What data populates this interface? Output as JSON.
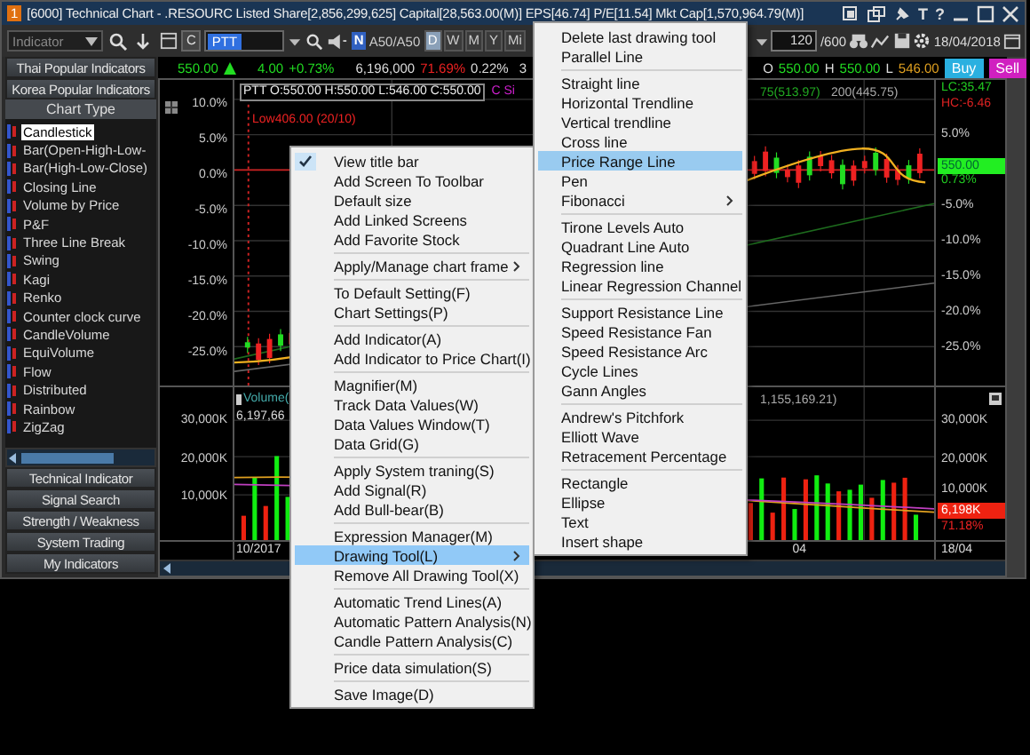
{
  "window": {
    "badge": "1",
    "title": "[6000] Technical Chart - .RESOURC Listed Share[2,856,299,625] Capital[28,563.00(M)] EPS[46.74] P/E[11.54] Mkt Cap[1,570,964.79(M)]",
    "title_buttons": [
      "T",
      "?"
    ]
  },
  "toolbar": {
    "indicator_dropdown": "Indicator",
    "c_button": "C",
    "symbol": "PTT",
    "market_badge": "N",
    "market": "A50/A50",
    "periods": [
      {
        "label": "D",
        "selected": true
      },
      {
        "label": "W",
        "selected": false
      },
      {
        "label": "M",
        "selected": false
      },
      {
        "label": "Y",
        "selected": false
      },
      {
        "label": "Mi",
        "selected": false
      }
    ],
    "count": "120",
    "count_max": "/600",
    "date": "18/04/2018"
  },
  "quote": {
    "last": "550.00",
    "change": "4.00",
    "change_pct": "+0.73%",
    "volume": "6,196,000",
    "ratio": "71.69%",
    "share": "0.22%",
    "column_7": "3",
    "open_label": "O",
    "open": "550.00",
    "high_label": "H",
    "high": "550.00",
    "low_label": "L",
    "low": "546.00",
    "buy": "Buy",
    "sell": "Sell"
  },
  "sidebar": {
    "top_buttons": [
      "Thai Popular Indicators",
      "Korea Popular Indicators"
    ],
    "section": "Chart Type",
    "items": [
      {
        "label": "Candlestick",
        "selected": true
      },
      {
        "label": "Bar(Open-High-Low-",
        "selected": false
      },
      {
        "label": "Bar(High-Low-Close)",
        "selected": false
      },
      {
        "label": "Closing Line",
        "selected": false
      },
      {
        "label": "Volume by Price",
        "selected": false
      },
      {
        "label": "P&F",
        "selected": false
      },
      {
        "label": "Three Line Break",
        "selected": false
      },
      {
        "label": "Swing",
        "selected": false
      },
      {
        "label": "Kagi",
        "selected": false
      },
      {
        "label": "Renko",
        "selected": false
      },
      {
        "label": "Counter clock curve",
        "selected": false
      },
      {
        "label": "CandleVolume",
        "selected": false
      },
      {
        "label": "EquiVolume",
        "selected": false
      },
      {
        "label": "Flow",
        "selected": false
      },
      {
        "label": "Distributed",
        "selected": false
      },
      {
        "label": "Rainbow",
        "selected": false
      },
      {
        "label": "ZigZag",
        "selected": false
      }
    ],
    "bottom_buttons": [
      "Technical Indicator",
      "Signal Search",
      "Strength / Weakness",
      "System Trading",
      "My Indicators"
    ]
  },
  "price_pane": {
    "legend": "PTT O:550.00 H:550.00 L:546.00 C:550.00",
    "signal_legend": "C Si",
    "ma_legend": "75(513.97)",
    "ma_legend_2": "200(445.75)",
    "low_note": "Low406.00 (20/10)",
    "left_ticks": [
      "10.0%",
      "5.0%",
      "0.0%",
      "-5.0%",
      "-10.0%",
      "-15.0%",
      "-20.0%",
      "-25.0%"
    ],
    "lc": "LC:35.47",
    "hc": "HC:-6.46",
    "right_ticks": [
      "5.0%",
      "-5.0%",
      "-10.0%",
      "-15.0%",
      "-20.0%",
      "-25.0%"
    ],
    "price_tag": "550.00",
    "change_tag": "0.73%"
  },
  "volume_pane": {
    "legend": "Volume(",
    "value": "6,197,66",
    "ma_legend": "1,155,169.21)",
    "left_ticks": [
      "30,000K",
      "20,000K",
      "10,000K"
    ],
    "right_ticks": [
      "30,000K",
      "20,000K",
      "10,000K"
    ],
    "volume_tag": "6,198K",
    "ratio_tag": "71.18%"
  },
  "date_axis": {
    "labels": [
      "10/2017",
      "04"
    ],
    "tag": "18/04"
  },
  "context_menu": {
    "groups": [
      [
        {
          "label": "View title bar",
          "checked": true,
          "selected": false,
          "has_submenu": false
        },
        {
          "label": "Add Screen To Toolbar",
          "checked": false,
          "selected": false,
          "has_submenu": false
        },
        {
          "label": "Default size",
          "checked": false,
          "selected": false,
          "has_submenu": false
        },
        {
          "label": "Add Linked Screens",
          "checked": false,
          "selected": false,
          "has_submenu": false
        },
        {
          "label": "Add Favorite Stock",
          "checked": false,
          "selected": false,
          "has_submenu": false
        }
      ],
      [
        {
          "label": "Apply/Manage chart frame",
          "checked": false,
          "selected": false,
          "has_submenu": true
        }
      ],
      [
        {
          "label": "To Default Setting(F)",
          "checked": false,
          "selected": false,
          "has_submenu": false
        },
        {
          "label": "Chart Settings(P)",
          "checked": false,
          "selected": false,
          "has_submenu": false
        }
      ],
      [
        {
          "label": "Add Indicator(A)",
          "checked": false,
          "selected": false,
          "has_submenu": false
        },
        {
          "label": "Add Indicator to Price Chart(I)",
          "checked": false,
          "selected": false,
          "has_submenu": false
        }
      ],
      [
        {
          "label": "Magnifier(M)",
          "checked": false,
          "selected": false,
          "has_submenu": false
        },
        {
          "label": "Track Data Values(W)",
          "checked": false,
          "selected": false,
          "has_submenu": false
        },
        {
          "label": "Data Values Window(T)",
          "checked": false,
          "selected": false,
          "has_submenu": false
        },
        {
          "label": "Data Grid(G)",
          "checked": false,
          "selected": false,
          "has_submenu": false
        }
      ],
      [
        {
          "label": "Apply System traning(S)",
          "checked": false,
          "selected": false,
          "has_submenu": false
        },
        {
          "label": "Add Signal(R)",
          "checked": false,
          "selected": false,
          "has_submenu": false
        },
        {
          "label": "Add Bull-bear(B)",
          "checked": false,
          "selected": false,
          "has_submenu": false
        }
      ],
      [
        {
          "label": "Expression Manager(M)",
          "checked": false,
          "selected": false,
          "has_submenu": false
        },
        {
          "label": "Drawing Tool(L)",
          "checked": false,
          "selected": true,
          "has_submenu": true
        },
        {
          "label": "Remove All Drawing Tool(X)",
          "checked": false,
          "selected": false,
          "has_submenu": false
        }
      ],
      [
        {
          "label": "Automatic Trend Lines(A)",
          "checked": false,
          "selected": false,
          "has_submenu": false
        },
        {
          "label": "Automatic Pattern Analysis(N)",
          "checked": false,
          "selected": false,
          "has_submenu": false
        },
        {
          "label": "Candle Pattern Analysis(C)",
          "checked": false,
          "selected": false,
          "has_submenu": false
        }
      ],
      [
        {
          "label": "Price data simulation(S)",
          "checked": false,
          "selected": false,
          "has_submenu": false
        }
      ],
      [
        {
          "label": "Save Image(D)",
          "checked": false,
          "selected": false,
          "has_submenu": false
        }
      ]
    ]
  },
  "drawing_tool_menu": {
    "groups": [
      [
        {
          "label": "Delete last drawing tool",
          "selected": false,
          "has_submenu": false
        },
        {
          "label": "Parallel Line",
          "selected": false,
          "has_submenu": false
        }
      ],
      [
        {
          "label": "Straight line",
          "selected": false,
          "has_submenu": false
        },
        {
          "label": "Horizontal Trendline",
          "selected": false,
          "has_submenu": false
        },
        {
          "label": "Vertical trendline",
          "selected": false,
          "has_submenu": false
        },
        {
          "label": "Cross line",
          "selected": false,
          "has_submenu": false
        },
        {
          "label": "Price Range Line",
          "selected": true,
          "has_submenu": false
        },
        {
          "label": "Pen",
          "selected": false,
          "has_submenu": false
        },
        {
          "label": "Fibonacci",
          "selected": false,
          "has_submenu": true
        }
      ],
      [
        {
          "label": "Tirone Levels Auto",
          "selected": false,
          "has_submenu": false
        },
        {
          "label": "Quadrant Line Auto",
          "selected": false,
          "has_submenu": false
        },
        {
          "label": "Regression line",
          "selected": false,
          "has_submenu": false
        },
        {
          "label": "Linear Regression Channel",
          "selected": false,
          "has_submenu": false
        }
      ],
      [
        {
          "label": "Support  Resistance Line",
          "selected": false,
          "has_submenu": false
        },
        {
          "label": "Speed Resistance Fan",
          "selected": false,
          "has_submenu": false
        },
        {
          "label": "Speed Resistance Arc",
          "selected": false,
          "has_submenu": false
        },
        {
          "label": "Cycle Lines",
          "selected": false,
          "has_submenu": false
        },
        {
          "label": "Gann Angles",
          "selected": false,
          "has_submenu": false
        }
      ],
      [
        {
          "label": "Andrew's Pitchfork",
          "selected": false,
          "has_submenu": false
        },
        {
          "label": "Elliott Wave",
          "selected": false,
          "has_submenu": false
        },
        {
          "label": "Retracement Percentage",
          "selected": false,
          "has_submenu": false
        }
      ],
      [
        {
          "label": "Rectangle",
          "selected": false,
          "has_submenu": false
        },
        {
          "label": "Ellipse",
          "selected": false,
          "has_submenu": false
        },
        {
          "label": "Text",
          "selected": false,
          "has_submenu": false
        },
        {
          "label": "Insert shape",
          "selected": false,
          "has_submenu": false
        }
      ]
    ]
  }
}
